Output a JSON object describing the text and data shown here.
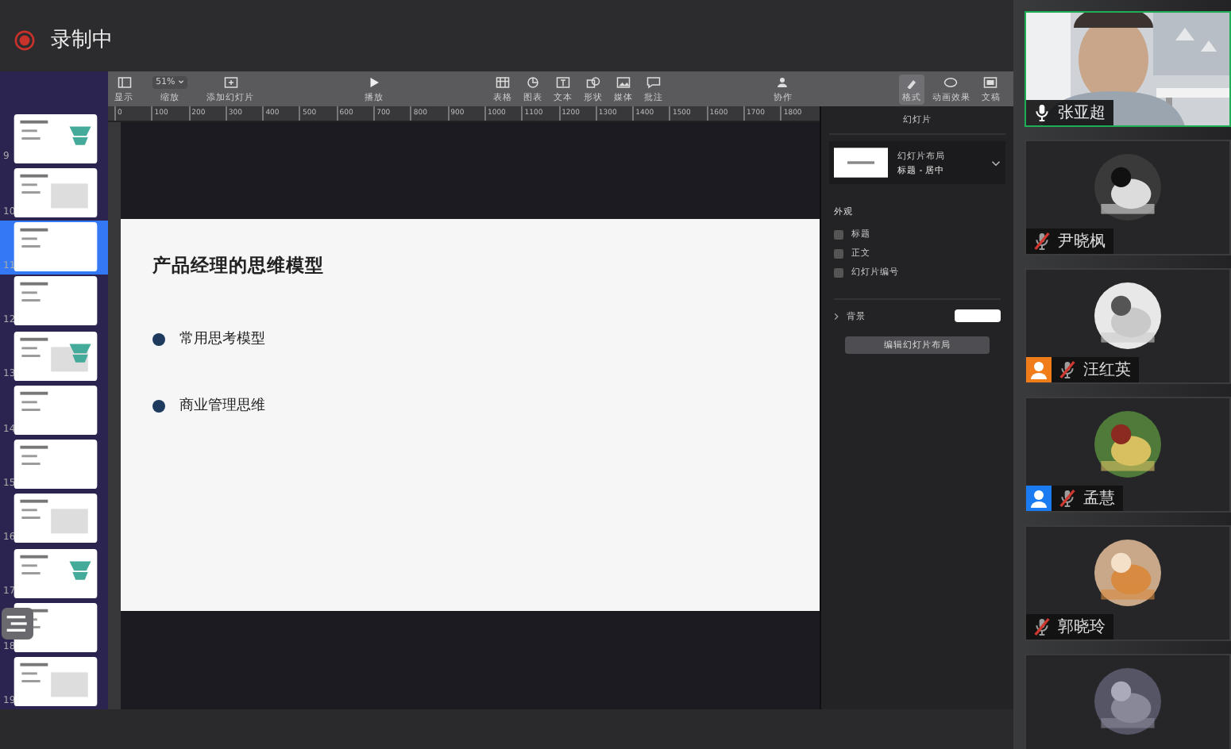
{
  "recording": {
    "label": "录制中"
  },
  "toolbar": {
    "zoom_value": "51%",
    "groups": [
      [
        {
          "kind": "view",
          "label": "显示"
        },
        {
          "kind": "zoom",
          "label": "缩放"
        },
        {
          "kind": "add-slide",
          "label": "添加幻灯片"
        }
      ],
      [
        {
          "kind": "play",
          "label": "播放"
        }
      ],
      [
        {
          "kind": "table",
          "label": "表格"
        },
        {
          "kind": "chart",
          "label": "图表"
        },
        {
          "kind": "text",
          "label": "文本"
        },
        {
          "kind": "shape",
          "label": "形状"
        },
        {
          "kind": "media",
          "label": "媒体"
        },
        {
          "kind": "comment",
          "label": "批注"
        }
      ],
      [
        {
          "kind": "collaborate",
          "label": "协作"
        }
      ],
      [
        {
          "kind": "format",
          "label": "格式",
          "selected": true
        },
        {
          "kind": "animate",
          "label": "动画效果",
          "selected": false
        },
        {
          "kind": "document",
          "label": "文稿",
          "selected": false
        }
      ]
    ]
  },
  "ruler": [
    "0",
    "100",
    "200",
    "300",
    "400",
    "500",
    "600",
    "700",
    "800",
    "900",
    "1000",
    "1100",
    "1200",
    "1300",
    "1400",
    "1500",
    "1600",
    "1700",
    "1800"
  ],
  "slides": [
    {
      "number": "9",
      "selected": false
    },
    {
      "number": "10",
      "selected": false
    },
    {
      "number": "11",
      "selected": true
    },
    {
      "number": "12",
      "selected": false
    },
    {
      "number": "13",
      "selected": false
    },
    {
      "number": "14",
      "selected": false
    },
    {
      "number": "15",
      "selected": false
    },
    {
      "number": "16",
      "selected": false
    },
    {
      "number": "17",
      "selected": false
    },
    {
      "number": "18",
      "selected": false
    },
    {
      "number": "19",
      "selected": false
    }
  ],
  "slide": {
    "title": "产品经理的思维模型",
    "bullets": [
      "常用思考模型",
      "商业管理思维"
    ]
  },
  "inspector": {
    "title": "幻灯片",
    "layout_label": "幻灯片布局",
    "layout_value": "标题 - 居中",
    "appearance_title": "外观",
    "checkboxes": [
      {
        "label": "标题",
        "checked": false
      },
      {
        "label": "正文",
        "checked": false
      },
      {
        "label": "幻灯片编号",
        "checked": false
      }
    ],
    "background_label": "背景",
    "edit_button": "编辑幻灯片布局"
  },
  "participants": [
    {
      "kind": "video",
      "name": "张亚超",
      "muted": false,
      "speaking": true
    },
    {
      "kind": "avatar",
      "name": "尹晓枫",
      "muted": true,
      "speaking": false
    },
    {
      "kind": "avatar",
      "name": "汪红英",
      "muted": true,
      "speaking": false,
      "color": "#f07d1a"
    },
    {
      "kind": "avatar",
      "name": "孟慧",
      "muted": true,
      "speaking": false,
      "color": "#1a7cf0"
    },
    {
      "kind": "avatar",
      "name": "郭晓玲",
      "muted": true,
      "speaking": false
    },
    {
      "kind": "avatar",
      "speaking": false
    }
  ]
}
